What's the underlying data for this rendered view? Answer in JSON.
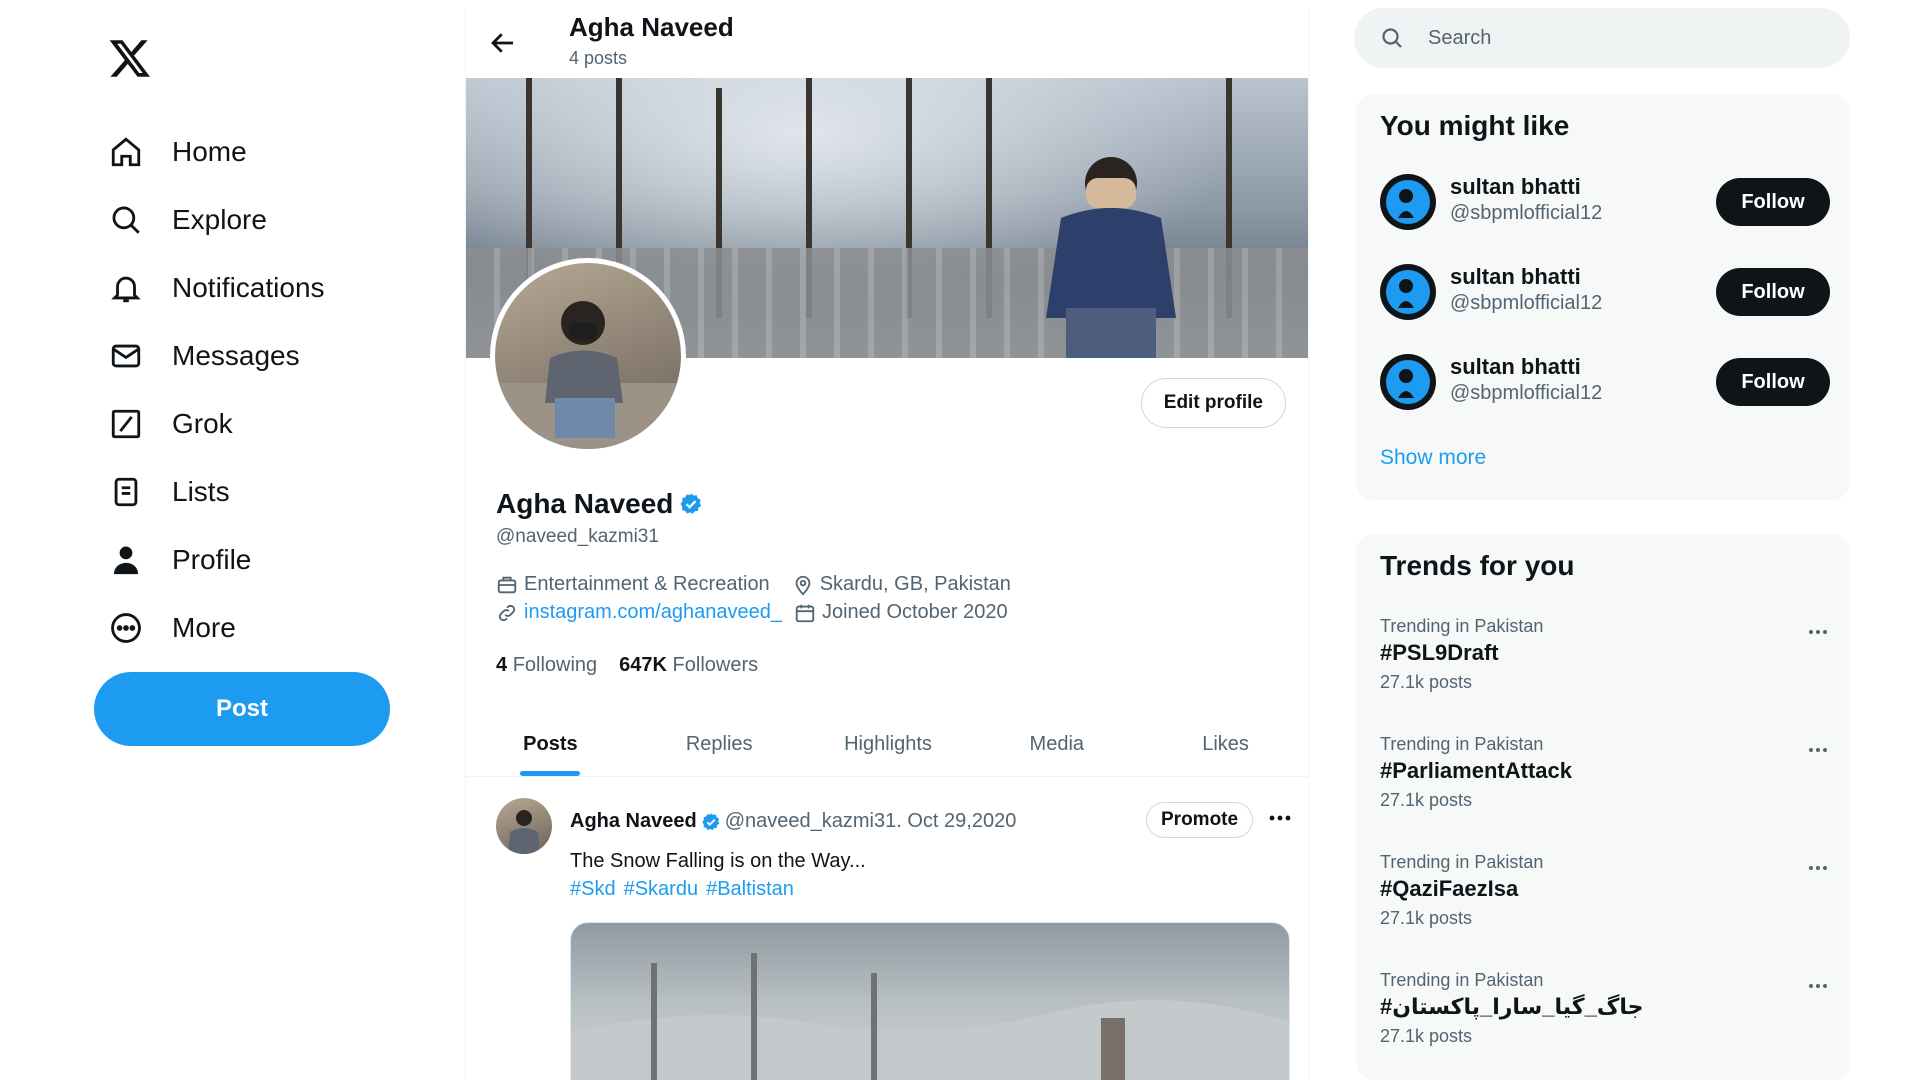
{
  "nav": {
    "logo": "x-logo-icon",
    "items": [
      {
        "label": "Home",
        "icon": "home-icon"
      },
      {
        "label": "Explore",
        "icon": "search-icon"
      },
      {
        "label": "Notifications",
        "icon": "bell-icon"
      },
      {
        "label": "Messages",
        "icon": "envelope-icon"
      },
      {
        "label": "Grok",
        "icon": "grok-icon"
      },
      {
        "label": "Lists",
        "icon": "list-icon"
      },
      {
        "label": "Profile",
        "icon": "person-icon"
      },
      {
        "label": "More",
        "icon": "more-circle-icon"
      }
    ],
    "post_label": "Post"
  },
  "header": {
    "name": "Agha Naveed",
    "post_count": "4 posts"
  },
  "profile": {
    "name": "Agha Naveed",
    "handle": "@naveed_kazmi31",
    "edit_label": "Edit profile",
    "category": "Entertainment & Recreation",
    "location": "Skardu, GB, Pakistan",
    "website": "instagram.com/aghanaveed_",
    "joined": "Joined October 2020",
    "following_count": "4",
    "following_label": "Following",
    "followers_count": "647K",
    "followers_label": "Followers"
  },
  "tabs": [
    {
      "label": "Posts",
      "active": true
    },
    {
      "label": "Replies",
      "active": false
    },
    {
      "label": "Highlights",
      "active": false
    },
    {
      "label": "Media",
      "active": false
    },
    {
      "label": "Likes",
      "active": false
    }
  ],
  "tweet": {
    "name": "Agha Naveed",
    "handle_date": "@naveed_kazmi31. Oct 29,2020",
    "promote_label": "Promote",
    "text": "The Snow Falling is on the Way...",
    "tags": [
      "#Skd",
      "#Skardu",
      "#Baltistan"
    ]
  },
  "search": {
    "placeholder": "Search"
  },
  "who_to_follow": {
    "title": "You might like",
    "items": [
      {
        "name": "sultan bhatti",
        "handle": "@sbpmlofficial12",
        "button": "Follow"
      },
      {
        "name": "sultan bhatti",
        "handle": "@sbpmlofficial12",
        "button": "Follow"
      },
      {
        "name": "sultan bhatti",
        "handle": "@sbpmlofficial12",
        "button": "Follow"
      }
    ],
    "show_more": "Show more"
  },
  "trends": {
    "title": "Trends for you",
    "items": [
      {
        "context": "Trending in Pakistan",
        "tag": "#PSL9Draft",
        "count": "27.1k posts"
      },
      {
        "context": "Trending in Pakistan",
        "tag": "#ParliamentAttack",
        "count": "27.1k posts"
      },
      {
        "context": "Trending in Pakistan",
        "tag": "#QaziFaezIsa",
        "count": "27.1k posts"
      },
      {
        "context": "Trending in Pakistan",
        "tag": "#جاگ_گیا_سارا_پاکستان",
        "count": "27.1k posts"
      }
    ]
  },
  "colors": {
    "accent": "#1d9bf0",
    "text": "#0f1419",
    "secondary": "#536471",
    "follow_bg": "#0f1419"
  }
}
